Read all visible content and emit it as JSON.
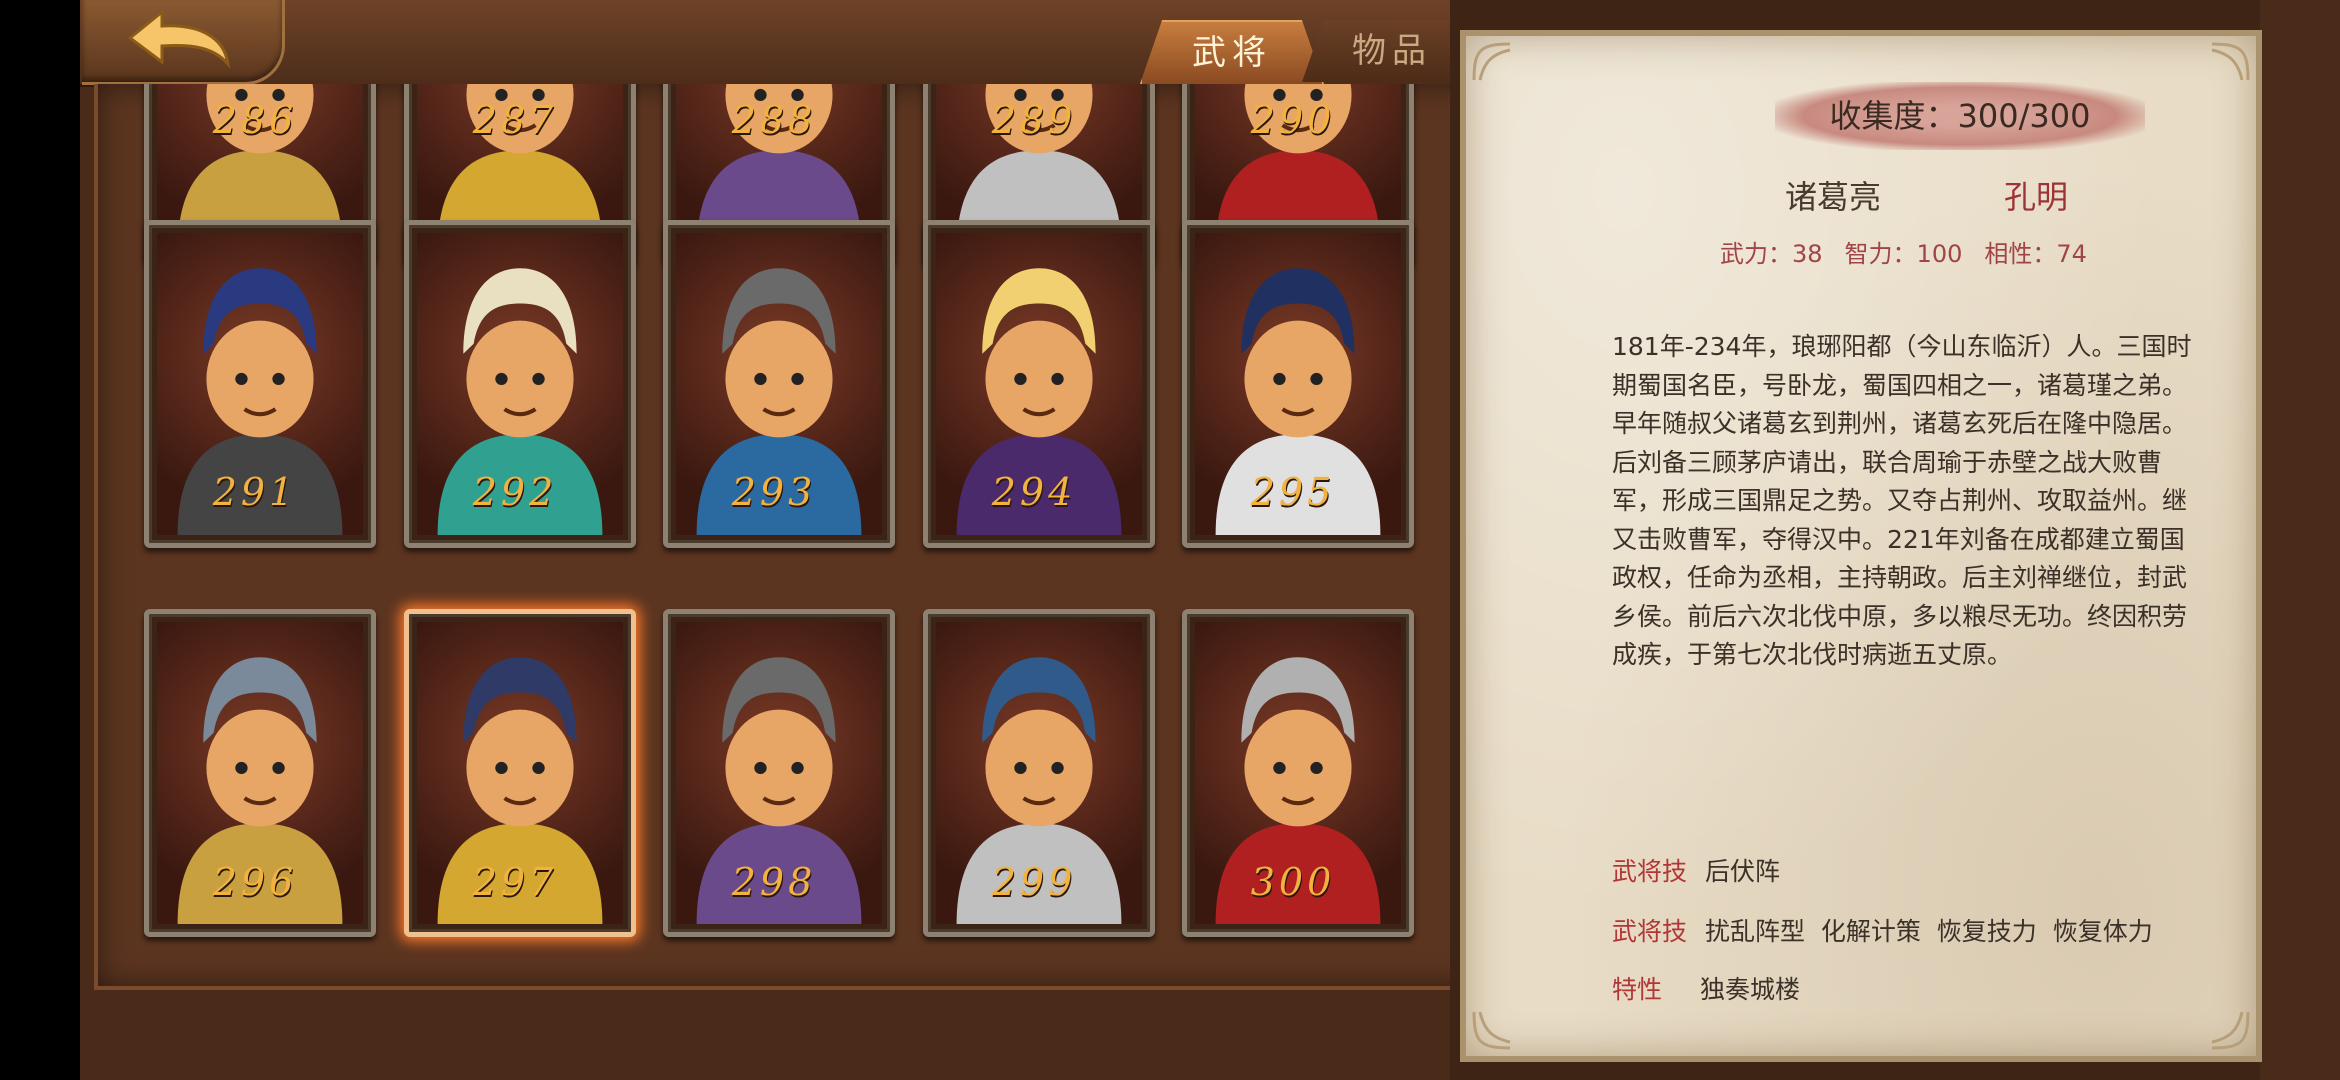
{
  "tabs": {
    "generals": "武将",
    "items": "物品"
  },
  "grid": {
    "cards": [
      {
        "number": "286"
      },
      {
        "number": "287"
      },
      {
        "number": "288"
      },
      {
        "number": "289"
      },
      {
        "number": "290"
      },
      {
        "number": "291"
      },
      {
        "number": "292"
      },
      {
        "number": "293"
      },
      {
        "number": "294"
      },
      {
        "number": "295"
      },
      {
        "number": "296"
      },
      {
        "number": "297"
      },
      {
        "number": "298"
      },
      {
        "number": "299"
      },
      {
        "number": "300"
      }
    ],
    "selected_number": "297"
  },
  "detail": {
    "collection": "收集度：300/300",
    "name": "诸葛亮",
    "courtesy_name": "孔明",
    "stats": {
      "strength_label": "武力：",
      "strength": "38",
      "intellect_label": "智力：",
      "intellect": "100",
      "affinity_label": "相性：",
      "affinity": "74"
    },
    "bio": "181年-234年，琅琊阳都（今山东临沂）人。三国时期蜀国名臣，号卧龙，蜀国四相之一，诸葛瑾之弟。\n早年随叔父诸葛玄到荆州，诸葛玄死后在隆中隐居。后刘备三顾茅庐请出，联合周瑜于赤壁之战大败曹军，形成三国鼎足之势。又夺占荆州、攻取益州。继又击败曹军，夺得汉中。221年刘备在成都建立蜀国政权，任命为丞相，主持朝政。后主刘禅继位，封武乡侯。前后六次北伐中原，多以粮尽无功。终因积劳成疾，于第七次北伐时病逝五丈原。",
    "skill1_label": "武将技",
    "skill1_value": "后伏阵",
    "skill2_label": "武将技",
    "skill2_value": "扰乱阵型  化解计策  恢复技力  恢复体力",
    "trait_label": "特性",
    "trait_value": "独奏城楼"
  },
  "colors": {
    "accent_orange": "#f1b23f",
    "skill_red": "#b13636",
    "selected_glow": "#ff7a2a"
  }
}
